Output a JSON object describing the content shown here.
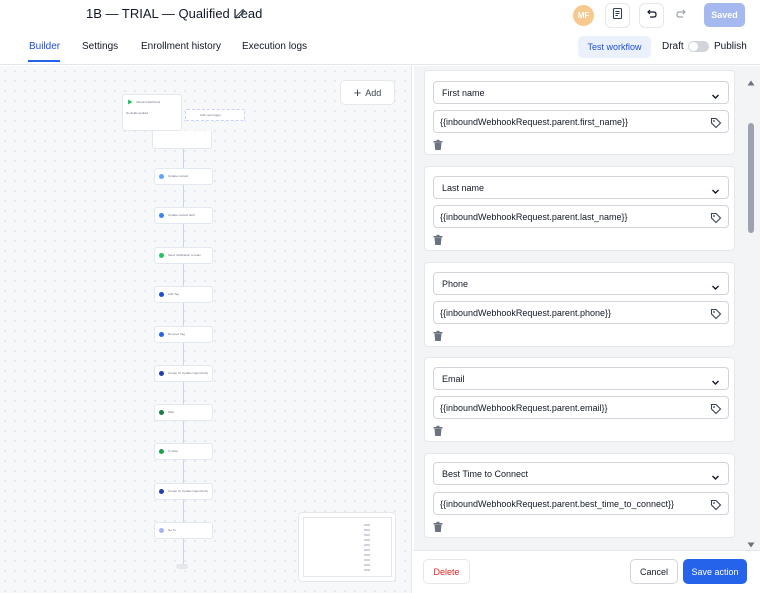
{
  "header": {
    "title": "1B — TRIAL — Qualified Lead",
    "avatar_initials": "MF",
    "saved_label": "Saved"
  },
  "tabs": [
    {
      "label": "Builder",
      "active": true
    },
    {
      "label": "Settings",
      "active": false
    },
    {
      "label": "Enrollment history",
      "active": false
    },
    {
      "label": "Execution logs",
      "active": false
    }
  ],
  "toolbar": {
    "test_workflow_label": "Test workflow",
    "draft_label": "Draft",
    "publish_label": "Publish",
    "publish_on": false
  },
  "canvas": {
    "add_label": "Add",
    "trigger_label": "Inbound Webhook",
    "trigger_sub": "No fields applied",
    "add_trigger_label": "Add new trigger",
    "steps": [
      {
        "label": "Update contact",
        "color": "#60a5fa"
      },
      {
        "label": "Update contact field",
        "color": "#3b82f6"
      },
      {
        "label": "Send notification to team",
        "color": "#22c55e"
      },
      {
        "label": "Add Tag",
        "color": "#1d4ed8"
      },
      {
        "label": "Remove Tag",
        "color": "#2563eb"
      },
      {
        "label": "Create Or Update Opportunity",
        "color": "#1e40af"
      },
      {
        "label": "Wait",
        "color": "#15803d"
      },
      {
        "label": "If / Else",
        "color": "#16a34a"
      },
      {
        "label": "Create Or Update Opportunity",
        "color": "#1e40af"
      },
      {
        "label": "Go To",
        "color": "#a5b4fc"
      }
    ]
  },
  "panel": {
    "fields": [
      {
        "select": "First name",
        "value": "{{inboundWebhookRequest.parent.first_name}}"
      },
      {
        "select": "Last name",
        "value": "{{inboundWebhookRequest.parent.last_name}}"
      },
      {
        "select": "Phone",
        "value": "{{inboundWebhookRequest.parent.phone}}"
      },
      {
        "select": "Email",
        "value": "{{inboundWebhookRequest.parent.email}}"
      },
      {
        "select": "Best Time to Connect",
        "value": "{{inboundWebhookRequest.parent.best_time_to_connect}}"
      }
    ],
    "delete_label": "Delete",
    "cancel_label": "Cancel",
    "save_label": "Save action"
  }
}
